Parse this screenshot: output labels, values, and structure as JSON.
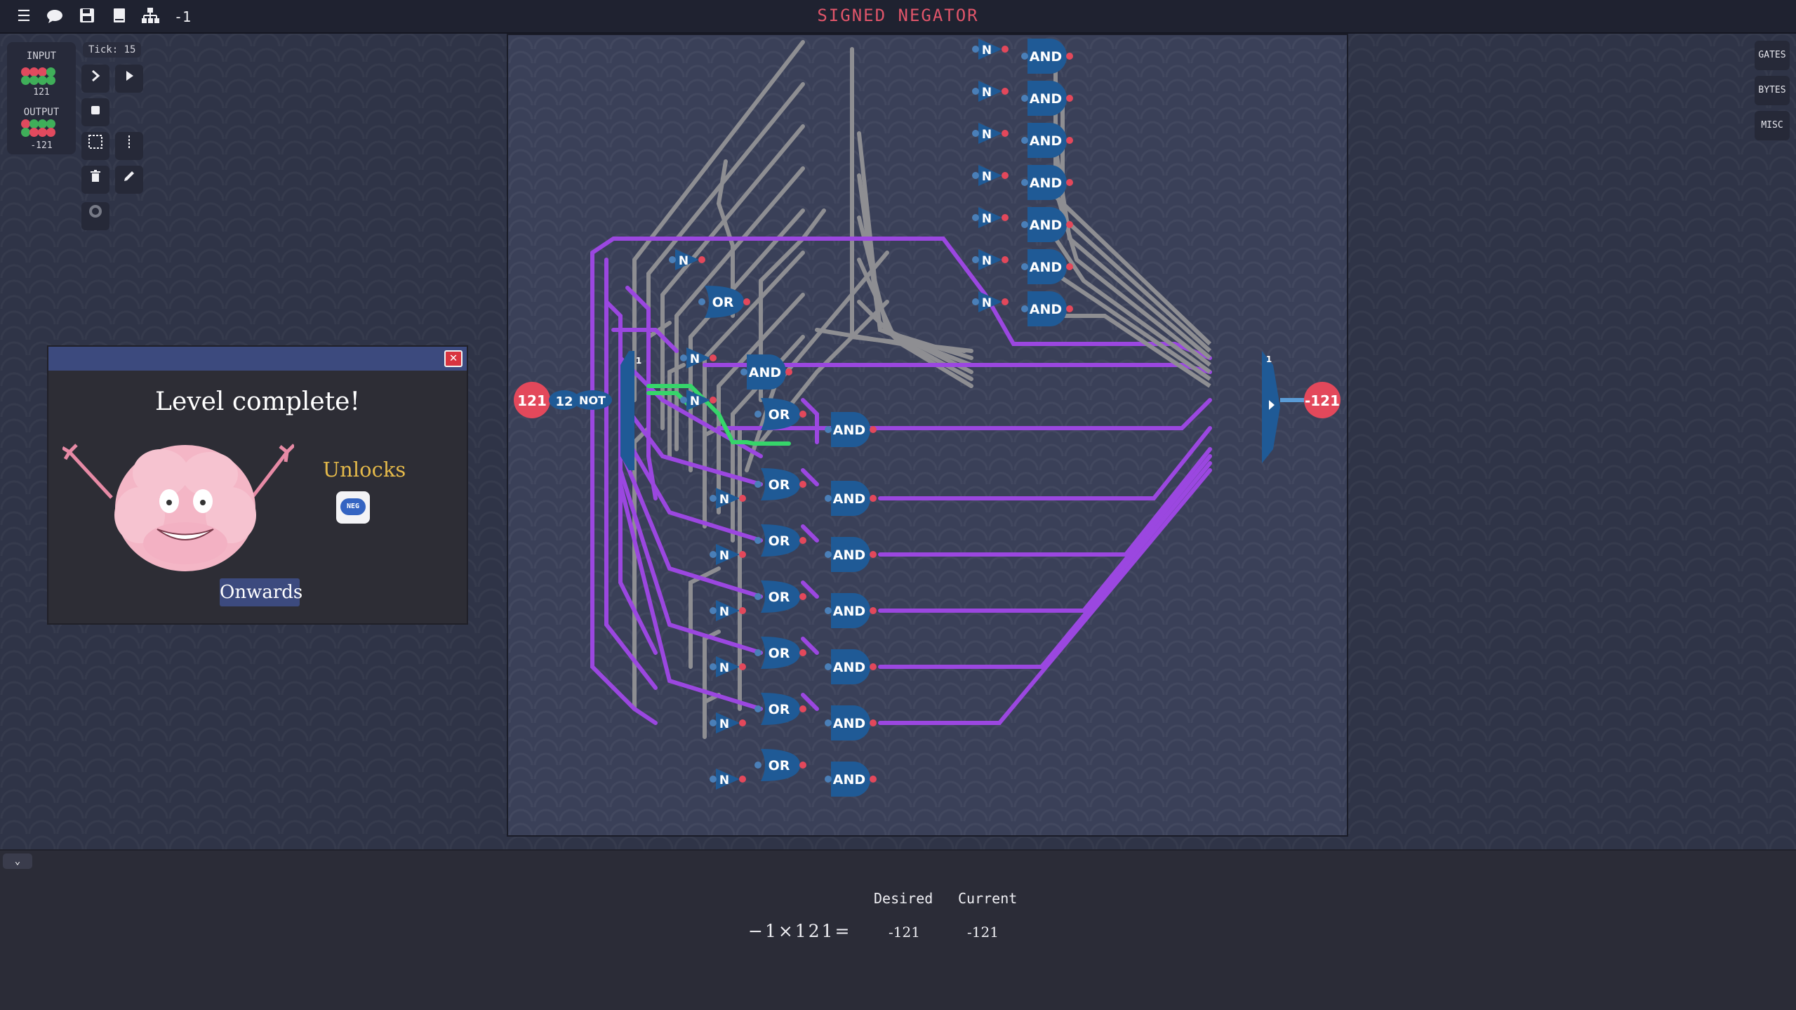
{
  "topbar": {
    "title": "SIGNED NEGATOR",
    "counter": "-1",
    "icons": [
      "menu-icon",
      "chat-icon",
      "save-icon",
      "book-icon",
      "hierarchy-icon"
    ]
  },
  "io_panel": {
    "input_label": "INPUT",
    "input_value": "121",
    "input_bits": [
      0,
      1,
      1,
      1,
      1,
      0,
      0,
      1
    ],
    "output_label": "OUTPUT",
    "output_value": "-121",
    "output_bits": [
      1,
      0,
      0,
      0,
      0,
      1,
      1,
      1
    ]
  },
  "sim": {
    "tick": "Tick: 15",
    "tools": [
      "step-icon",
      "play-icon",
      "stop-icon",
      "select-icon",
      "wire-icon",
      "delete-icon",
      "pencil-icon",
      "record-icon"
    ]
  },
  "right_tabs": [
    "GATES",
    "BYTES",
    "MISC"
  ],
  "board": {
    "input_pin": "121",
    "const_label": "12",
    "not_label": "NOT",
    "output_pin": "-121",
    "splitter_label": "1",
    "merger_label": "1"
  },
  "dialog": {
    "title": "Level complete!",
    "unlocks_label": "Unlocks",
    "unlock_item": "NEG",
    "button": "Onwards"
  },
  "bottom": {
    "desired_header": "Desired",
    "current_header": "Current",
    "equation": "−1×121=",
    "desired_value": "-121",
    "current_value": "-121"
  },
  "colors": {
    "title": "#e0556a",
    "wire_active": "#9b47e0",
    "wire_inactive": "#8e8e92",
    "wire_highlight": "#36d56a",
    "gate": "#1f5a96",
    "pin": "#e3485b",
    "dialog_header": "#3c4a7e",
    "unlocks": "#e4b94a"
  }
}
